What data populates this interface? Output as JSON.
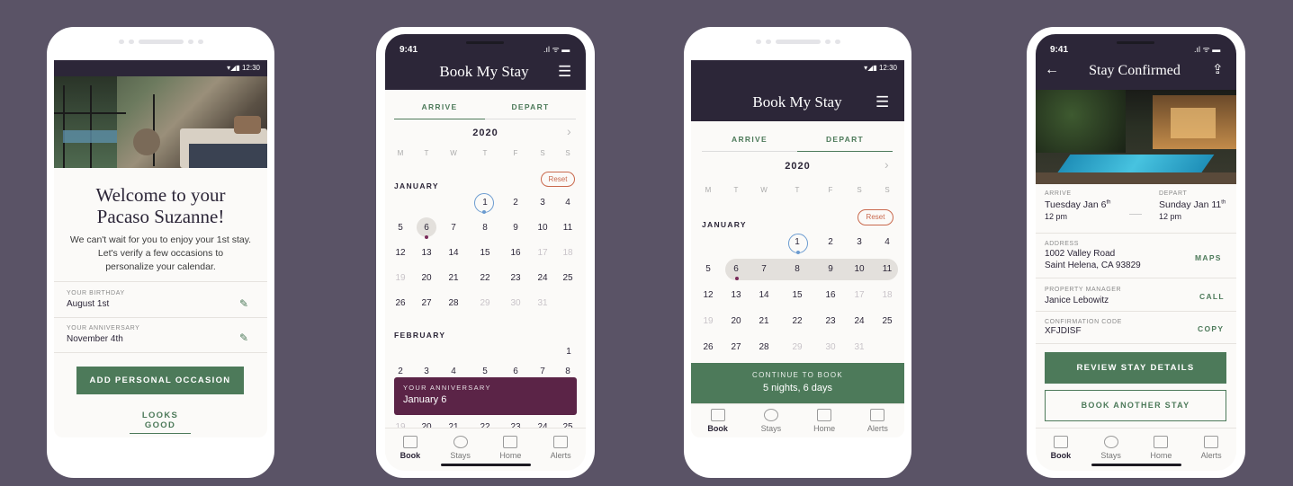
{
  "phone1": {
    "status_time": "12:30",
    "welcome_title_l1": "Welcome to your",
    "welcome_title_l2": "Pacaso Suzanne!",
    "welcome_body_l1": "We can't wait for you to enjoy your 1st stay.",
    "welcome_body_l2": "Let's verify a few occasions to",
    "welcome_body_l3": "personalize your calendar.",
    "birthday_label": "YOUR BIRTHDAY",
    "birthday_value": "August 1st",
    "anniversary_label": "YOUR ANNIVERSARY",
    "anniversary_value": "November 4th",
    "add_button": "ADD PERSONAL OCCASION",
    "looks_good": "LOOKS GOOD"
  },
  "phone2": {
    "status_time": "9:41",
    "title": "Book My Stay",
    "tab_arrive": "ARRIVE",
    "tab_depart": "DEPART",
    "year": "2020",
    "dow": [
      "M",
      "T",
      "W",
      "T",
      "F",
      "S",
      "S"
    ],
    "month1": "JANUARY",
    "reset": "Reset",
    "month2": "FEBRUARY",
    "anniv_label": "YOUR ANNIVERSARY",
    "anniv_date": "January 6",
    "tabs": [
      "Book",
      "Stays",
      "Home",
      "Alerts"
    ]
  },
  "phone3": {
    "status_time": "12:30",
    "title": "Book My Stay",
    "tab_arrive": "ARRIVE",
    "tab_depart": "DEPART",
    "year": "2020",
    "dow": [
      "M",
      "T",
      "W",
      "T",
      "F",
      "S",
      "S"
    ],
    "month1": "JANUARY",
    "reset": "Reset",
    "continue_label": "CONTINUE TO BOOK",
    "continue_sub": "5 nights, 6 days",
    "tabs": [
      "Book",
      "Stays",
      "Home",
      "Alerts"
    ]
  },
  "phone4": {
    "status_time": "9:41",
    "title": "Stay Confirmed",
    "arrive_label": "ARRIVE",
    "arrive_date": "Tuesday Jan 6",
    "arrive_sup": "th",
    "arrive_time": "12 pm",
    "depart_label": "DEPART",
    "depart_date": "Sunday Jan 11",
    "depart_sup": "th",
    "depart_time": "12 pm",
    "address_label": "ADDRESS",
    "address_l1": "1002 Valley Road",
    "address_l2": "Saint Helena, CA 93829",
    "maps": "MAPS",
    "pm_label": "PROPERTY MANAGER",
    "pm_value": "Janice Lebowitz",
    "call": "CALL",
    "code_label": "CONFIRMATION CODE",
    "code_value": "XFJDISF",
    "copy": "COPY",
    "review_button": "REVIEW STAY DETAILS",
    "book_another": "BOOK ANOTHER STAY",
    "tabs": [
      "Book",
      "Stays",
      "Home",
      "Alerts"
    ]
  },
  "colors": {
    "background": "#5a5366",
    "navy": "#2c2638",
    "green": "#4d7a5a",
    "plum": "#5b2447",
    "reset_red": "#c9694d"
  }
}
